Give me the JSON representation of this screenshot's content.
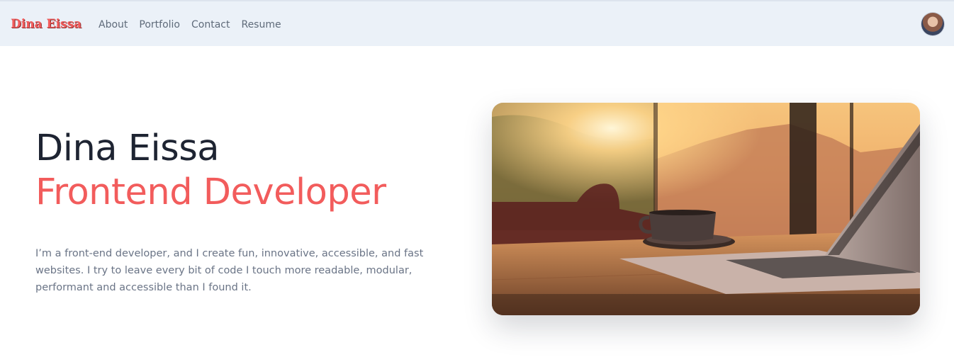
{
  "nav": {
    "brand": "Dina Eissa",
    "links": [
      "About",
      "Portfolio",
      "Contact",
      "Resume"
    ],
    "avatar_icon": "avatar"
  },
  "hero": {
    "name": "Dina Eissa",
    "role": "Frontend Developer",
    "description": "I’m a front-end developer, and I create fun, innovative, accessible, and fast websites. I try to leave every bit of code I touch more readable, modular, performant and accessible than I found it.",
    "image_icon": "laptop-coffee-photo"
  },
  "colors": {
    "accent": "#f25c5c",
    "nav_bg": "#ebf1f8",
    "heading": "#1e2432",
    "body_text": "#6a7486"
  }
}
